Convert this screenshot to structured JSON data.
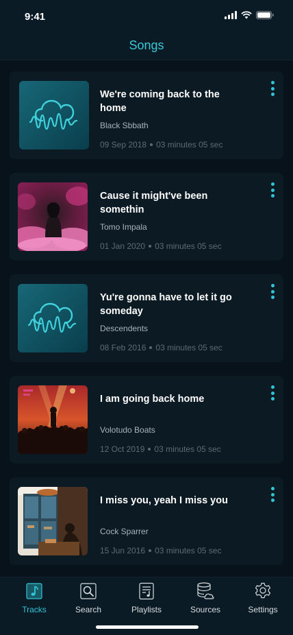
{
  "status": {
    "time": "9:41"
  },
  "header": {
    "title": "Songs"
  },
  "songs": [
    {
      "title": "We're coming back to the home",
      "artist": "Black Sbbath",
      "date": "09 Sep 2018",
      "duration": "03 minutes 05 sec",
      "art": "cloud-wave-icon"
    },
    {
      "title": "Cause it might've been somethin",
      "artist": "Tomo Impala",
      "date": "01 Jan 2020",
      "duration": "03 minutes 05 sec",
      "art": "pink-smoke-photo"
    },
    {
      "title": "Yu're gonna have to let it go someday",
      "artist": "Descendents",
      "date": "08 Feb 2016",
      "duration": "03 minutes 05 sec",
      "art": "cloud-wave-icon"
    },
    {
      "title": "I am going back home",
      "artist": "Volotudo Boats",
      "date": "12 Oct 2019",
      "duration": "03 minutes 05 sec",
      "art": "concert-photo"
    },
    {
      "title": "I miss you, yeah I miss you",
      "artist": "Cock Sparrer",
      "date": "15 Jun 2016",
      "duration": "03 minutes 05 sec",
      "art": "window-person-photo"
    }
  ],
  "tabs": [
    {
      "label": "Tracks",
      "icon": "music-note-icon",
      "active": true
    },
    {
      "label": "Search",
      "icon": "search-icon",
      "active": false
    },
    {
      "label": "Playlists",
      "icon": "playlist-icon",
      "active": false
    },
    {
      "label": "Sources",
      "icon": "database-cloud-icon",
      "active": false
    },
    {
      "label": "Settings",
      "icon": "gear-icon",
      "active": false
    }
  ],
  "colors": {
    "accent": "#2fc6d8",
    "background": "#07121a",
    "card": "#0c1a24"
  }
}
